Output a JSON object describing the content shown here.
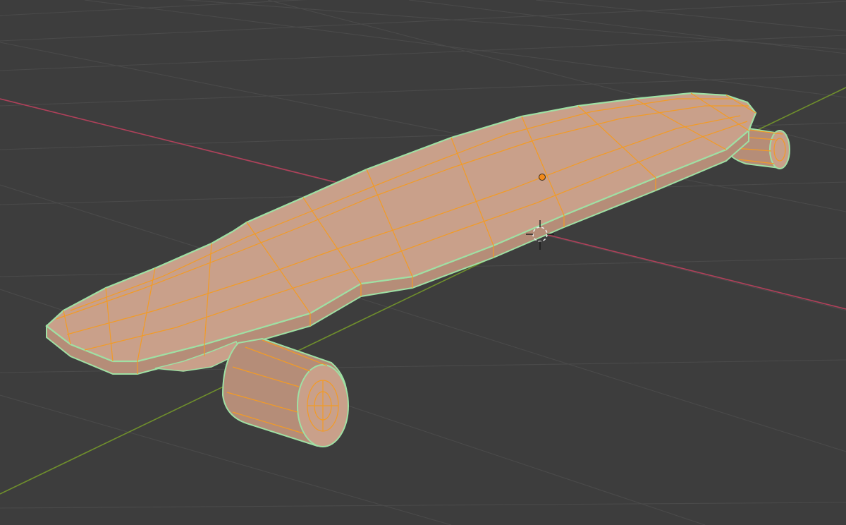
{
  "app": {
    "name": "3D viewport",
    "mode": "edit-mode-wireframe-overlay"
  },
  "viewport": {
    "background_color": "#3d3d3d",
    "grid_color": "#4a4a4a",
    "x_axis_color": "#b0405a",
    "y_axis_color": "#6f8f2c"
  },
  "object": {
    "type": "longboard-skateboard-mesh",
    "face_color": "#c9a08a",
    "side_color": "#b58d78",
    "wire_color": "#f29b26",
    "outline_color": "#9fe0a4",
    "origin_color": "#f28a1b",
    "wheels": 2,
    "selected": true
  },
  "cursor": {
    "icon": "3d-cursor-icon"
  }
}
